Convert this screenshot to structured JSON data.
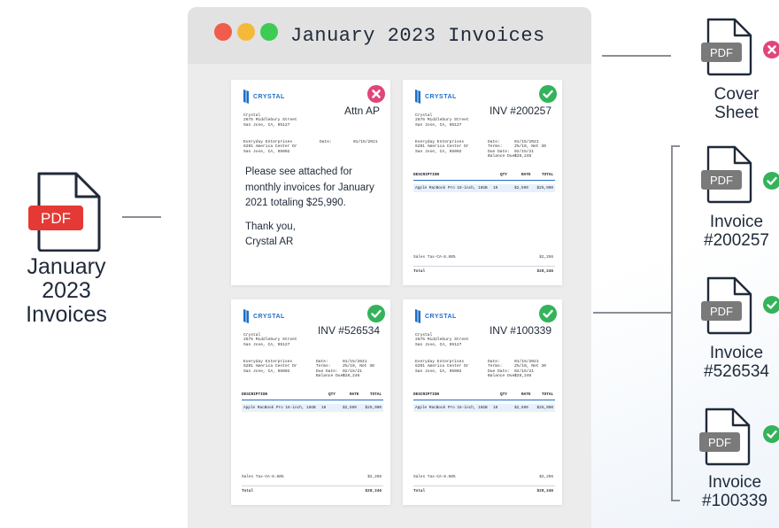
{
  "colors": {
    "accent_blue": "#1d6fc7",
    "check_green": "#34b35a",
    "reject_pink": "#e0457b",
    "pdf_red": "#e53935",
    "pdf_gray": "#7a7a7a",
    "connector": "#8a8f96"
  },
  "source": {
    "icon": "pdf-file-icon",
    "badge": "PDF",
    "label_line1": "January 2023",
    "label_line2": "Invoices"
  },
  "window": {
    "title": "January 2023 Invoices",
    "controls": [
      "close-dot",
      "minimize-dot",
      "maximize-dot"
    ]
  },
  "logo_text": "CRYSTAL",
  "sender": {
    "line1": "Crystal",
    "line2": "2675 Middlebury Street",
    "line3": "San Jose, CA, 95127"
  },
  "recipient": {
    "line1": "Everyday Enterprises",
    "line2": "6201 America Center Dr",
    "line3": "San Jose, CA, 95002"
  },
  "cover": {
    "status": "reject",
    "heading": "Attn AP",
    "date_label": "Date:",
    "date_value": "01/15/2021",
    "body1": "Please see attached for monthly invoices for January 2021 totaling $25,990.",
    "body2_line1": "Thank you,",
    "body2_line2": "Crystal AR"
  },
  "invoice_meta": {
    "keys": "Date:\nTerms:\nDue Date:\nBalance Due:",
    "values": "01/15/2021\n2%/10, Net 30\n02/15/21\n$28,246"
  },
  "table": {
    "headers": [
      "DESCRIPTION",
      "QTY",
      "RATE",
      "TOTAL"
    ],
    "row": [
      "Apple MacBook Pro 16-inch, 16GB",
      "10",
      "$2,599",
      "$25,990"
    ],
    "sales_tax_label": "Sales Tax-CA-8.68%",
    "sales_tax_value": "$2,256",
    "total_label": "Total",
    "total_value": "$28,246"
  },
  "invoices": [
    {
      "number": "INV #200257",
      "status": "approved"
    },
    {
      "number": "INV #526534",
      "status": "approved"
    },
    {
      "number": "INV #100339",
      "status": "approved"
    }
  ],
  "outputs": [
    {
      "badge": "PDF",
      "line1": "Cover",
      "line2": "Sheet",
      "status": "reject"
    },
    {
      "badge": "PDF",
      "line1": "Invoice",
      "line2": "#200257",
      "status": "approved"
    },
    {
      "badge": "PDF",
      "line1": "Invoice",
      "line2": "#526534",
      "status": "approved"
    },
    {
      "badge": "PDF",
      "line1": "Invoice",
      "line2": "#100339",
      "status": "approved"
    }
  ]
}
